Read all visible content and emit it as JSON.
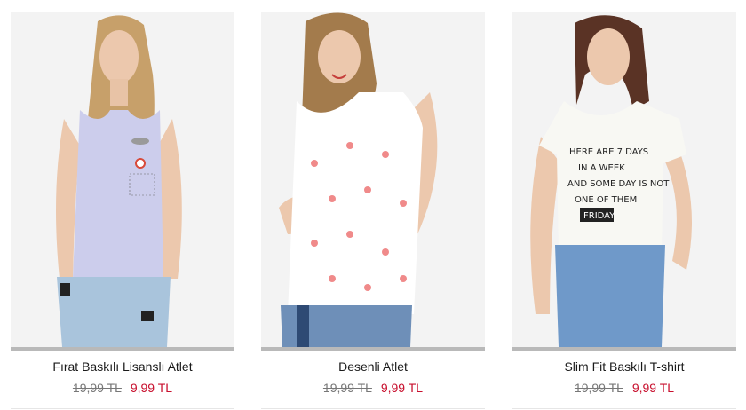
{
  "currency": "TL",
  "products": [
    {
      "name": "Fırat Baskılı Lisanslı Atlet",
      "old_price": "19,99 TL",
      "new_price": "9,99 TL",
      "image_alt": "tank-top-photo"
    },
    {
      "name": "Desenli Atlet",
      "old_price": "19,99 TL",
      "new_price": "9,99 TL",
      "image_alt": "patterned-tank-photo"
    },
    {
      "name": "Slim Fit Baskılı T-shirt",
      "old_price": "19,99 TL",
      "new_price": "9,99 TL",
      "image_alt": "printed-tshirt-photo",
      "print_text": [
        "HERE ARE 7 DAYS",
        "IN A WEEK",
        "AND SOME DAY IS NOT",
        "ONE OF THEM",
        "FRIDAY"
      ]
    }
  ],
  "colors": {
    "sale_price": "#c8102e",
    "old_price": "#777777",
    "title": "#1a1a1a",
    "image_bg": "#f1f1f1"
  }
}
